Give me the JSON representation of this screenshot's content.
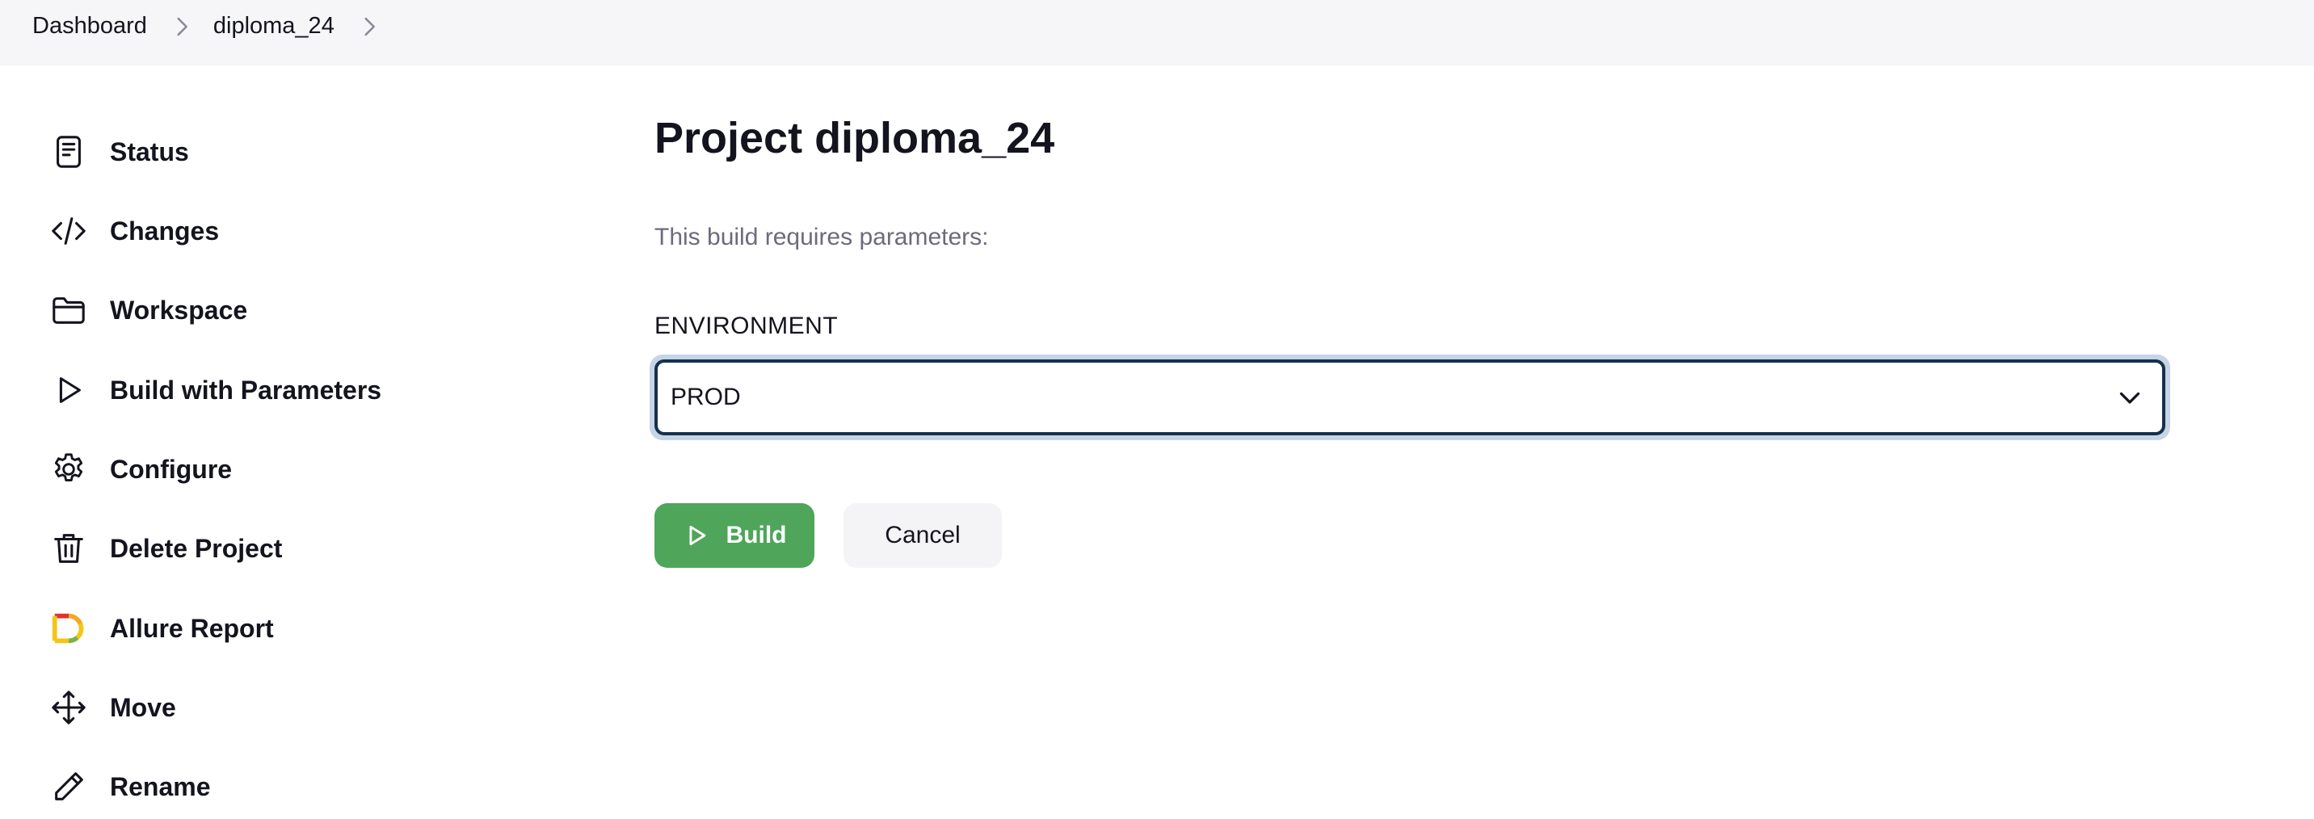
{
  "breadcrumb": {
    "items": [
      {
        "label": "Dashboard"
      },
      {
        "label": "diploma_24"
      }
    ]
  },
  "sidebar": {
    "items": [
      {
        "label": "Status",
        "icon": "document-icon"
      },
      {
        "label": "Changes",
        "icon": "code-icon"
      },
      {
        "label": "Workspace",
        "icon": "folder-icon"
      },
      {
        "label": "Build with Parameters",
        "icon": "play-icon"
      },
      {
        "label": "Configure",
        "icon": "gear-icon"
      },
      {
        "label": "Delete Project",
        "icon": "trash-icon"
      },
      {
        "label": "Allure Report",
        "icon": "allure-icon"
      },
      {
        "label": "Move",
        "icon": "move-icon"
      },
      {
        "label": "Rename",
        "icon": "pencil-icon"
      }
    ]
  },
  "main": {
    "title": "Project diploma_24",
    "subtitle": "This build requires parameters:",
    "parameter": {
      "name": "ENVIRONMENT",
      "selected": "PROD"
    },
    "build_label": "Build",
    "cancel_label": "Cancel"
  },
  "colors": {
    "build_button": "#4fa55a",
    "select_border": "#15304d",
    "select_focus_ring": "#c6d5e6",
    "breadcrumb_bg": "#f6f6f8"
  }
}
